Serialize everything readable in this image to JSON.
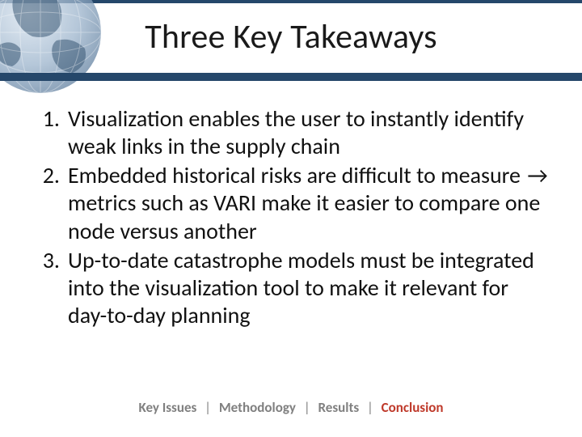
{
  "header": {
    "title": "Three Key Takeaways"
  },
  "list": {
    "items": [
      {
        "text": "Visualization enables the user to instantly identify weak links in the supply chain"
      },
      {
        "prefix": "Embedded historical risks are difficult to measure ",
        "arrow": "→",
        "suffix": " metrics such as VARI make it easier to compare one node versus another"
      },
      {
        "text": "Up-to-date catastrophe models must be integrated into the visualization tool to make it relevant for day-to-day planning"
      }
    ]
  },
  "footer": {
    "items": [
      {
        "label": "Key Issues",
        "active": false
      },
      {
        "label": "Methodology",
        "active": false
      },
      {
        "label": "Results",
        "active": false
      },
      {
        "label": "Conclusion",
        "active": true
      }
    ],
    "separator": "|"
  }
}
